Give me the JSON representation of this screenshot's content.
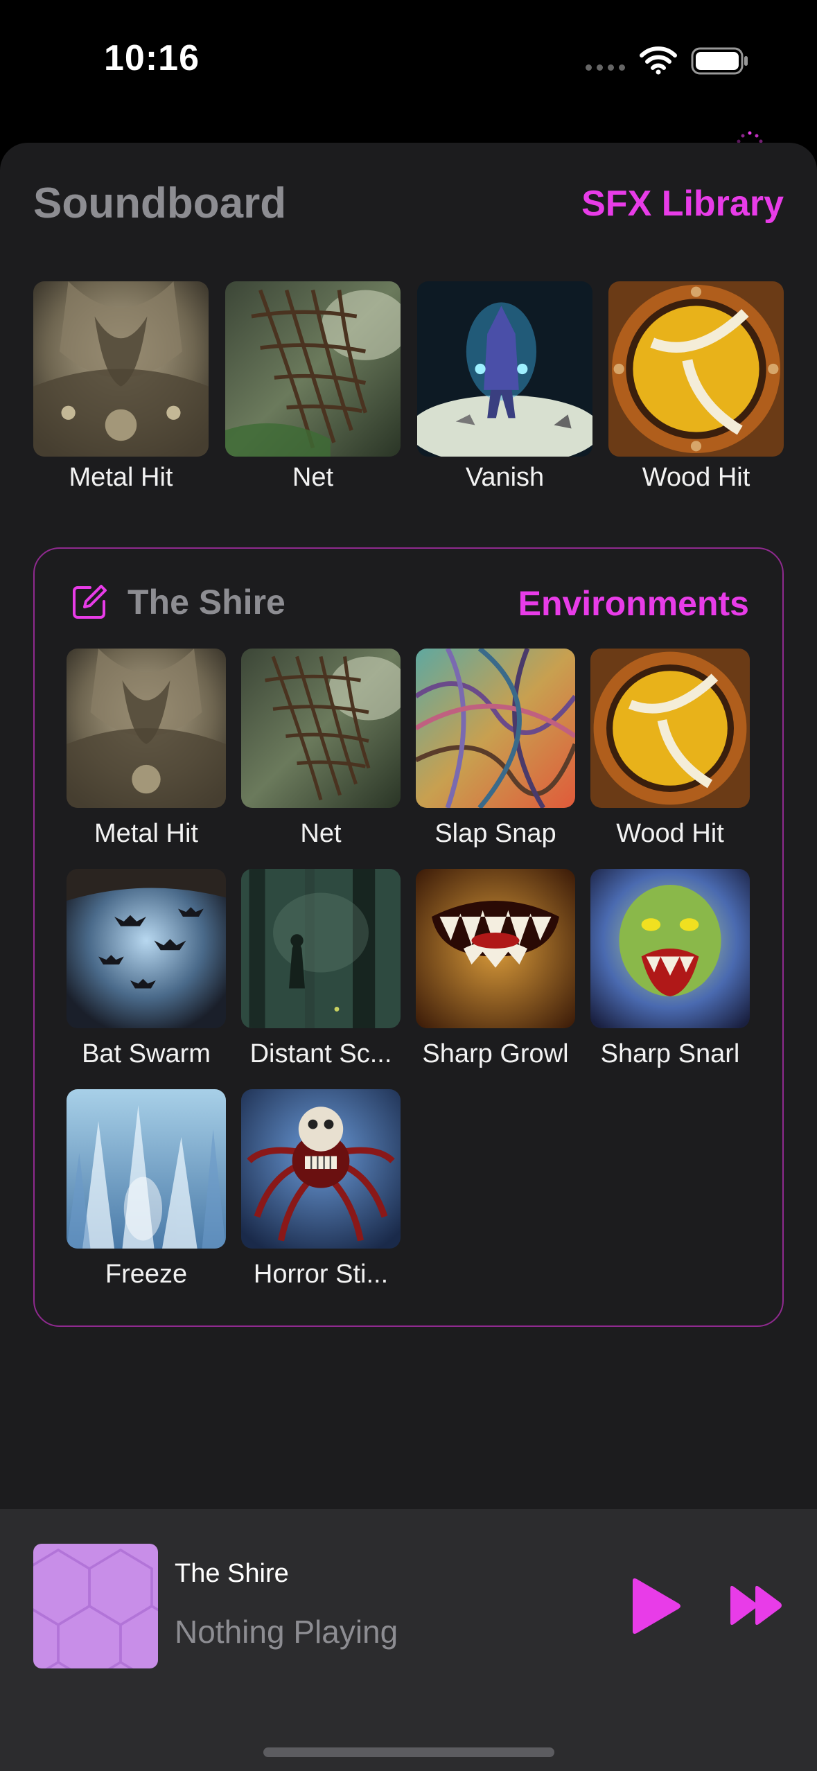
{
  "status_bar": {
    "time": "10:16"
  },
  "header": {
    "title": "Soundboard",
    "library_link": "SFX Library"
  },
  "top_sounds": [
    {
      "label": "Metal Hit",
      "art": "armor"
    },
    {
      "label": "Net",
      "art": "net"
    },
    {
      "label": "Vanish",
      "art": "wizard"
    },
    {
      "label": "Wood Hit",
      "art": "shield"
    }
  ],
  "group": {
    "title": "The Shire",
    "link": "Environments",
    "sounds": [
      {
        "label": "Metal Hit",
        "art": "armor"
      },
      {
        "label": "Net",
        "art": "net"
      },
      {
        "label": "Slap Snap",
        "art": "tangle"
      },
      {
        "label": "Wood Hit",
        "art": "shield"
      },
      {
        "label": "Bat Swarm",
        "art": "bats"
      },
      {
        "label": "Distant Sc...",
        "art": "forest"
      },
      {
        "label": "Sharp Growl",
        "art": "fangs"
      },
      {
        "label": "Sharp Snarl",
        "art": "monster"
      },
      {
        "label": "Freeze",
        "art": "ice"
      },
      {
        "label": "Horror Sti...",
        "art": "skull"
      }
    ]
  },
  "player": {
    "title": "The Shire",
    "status": "Nothing Playing"
  },
  "colors": {
    "accent": "#e83ce8",
    "sheet": "#1c1c1e",
    "player": "#2c2c2e",
    "muted": "#8d8d92"
  }
}
